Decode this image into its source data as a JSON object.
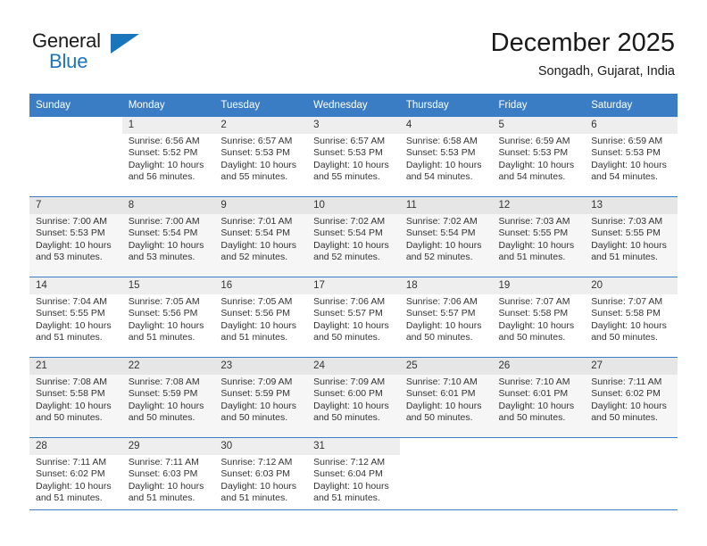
{
  "brand": {
    "name_part1": "General",
    "name_part2": "Blue",
    "logo_icon": "triangle-logo-icon"
  },
  "header": {
    "month_title": "December 2025",
    "location": "Songadh, Gujarat, India"
  },
  "calendar": {
    "weekday_headers": [
      "Sunday",
      "Monday",
      "Tuesday",
      "Wednesday",
      "Thursday",
      "Friday",
      "Saturday"
    ],
    "accent_color": "#3b7dc4",
    "daynum_band_color": "#eeeeee",
    "alt_row_color": "#f6f6f6",
    "weeks": [
      [
        {
          "day": "",
          "sunrise": "",
          "sunset": "",
          "daylight_line1": "",
          "daylight_line2": ""
        },
        {
          "day": "1",
          "sunrise": "Sunrise: 6:56 AM",
          "sunset": "Sunset: 5:52 PM",
          "daylight_line1": "Daylight: 10 hours",
          "daylight_line2": "and 56 minutes."
        },
        {
          "day": "2",
          "sunrise": "Sunrise: 6:57 AM",
          "sunset": "Sunset: 5:53 PM",
          "daylight_line1": "Daylight: 10 hours",
          "daylight_line2": "and 55 minutes."
        },
        {
          "day": "3",
          "sunrise": "Sunrise: 6:57 AM",
          "sunset": "Sunset: 5:53 PM",
          "daylight_line1": "Daylight: 10 hours",
          "daylight_line2": "and 55 minutes."
        },
        {
          "day": "4",
          "sunrise": "Sunrise: 6:58 AM",
          "sunset": "Sunset: 5:53 PM",
          "daylight_line1": "Daylight: 10 hours",
          "daylight_line2": "and 54 minutes."
        },
        {
          "day": "5",
          "sunrise": "Sunrise: 6:59 AM",
          "sunset": "Sunset: 5:53 PM",
          "daylight_line1": "Daylight: 10 hours",
          "daylight_line2": "and 54 minutes."
        },
        {
          "day": "6",
          "sunrise": "Sunrise: 6:59 AM",
          "sunset": "Sunset: 5:53 PM",
          "daylight_line1": "Daylight: 10 hours",
          "daylight_line2": "and 54 minutes."
        }
      ],
      [
        {
          "day": "7",
          "sunrise": "Sunrise: 7:00 AM",
          "sunset": "Sunset: 5:53 PM",
          "daylight_line1": "Daylight: 10 hours",
          "daylight_line2": "and 53 minutes."
        },
        {
          "day": "8",
          "sunrise": "Sunrise: 7:00 AM",
          "sunset": "Sunset: 5:54 PM",
          "daylight_line1": "Daylight: 10 hours",
          "daylight_line2": "and 53 minutes."
        },
        {
          "day": "9",
          "sunrise": "Sunrise: 7:01 AM",
          "sunset": "Sunset: 5:54 PM",
          "daylight_line1": "Daylight: 10 hours",
          "daylight_line2": "and 52 minutes."
        },
        {
          "day": "10",
          "sunrise": "Sunrise: 7:02 AM",
          "sunset": "Sunset: 5:54 PM",
          "daylight_line1": "Daylight: 10 hours",
          "daylight_line2": "and 52 minutes."
        },
        {
          "day": "11",
          "sunrise": "Sunrise: 7:02 AM",
          "sunset": "Sunset: 5:54 PM",
          "daylight_line1": "Daylight: 10 hours",
          "daylight_line2": "and 52 minutes."
        },
        {
          "day": "12",
          "sunrise": "Sunrise: 7:03 AM",
          "sunset": "Sunset: 5:55 PM",
          "daylight_line1": "Daylight: 10 hours",
          "daylight_line2": "and 51 minutes."
        },
        {
          "day": "13",
          "sunrise": "Sunrise: 7:03 AM",
          "sunset": "Sunset: 5:55 PM",
          "daylight_line1": "Daylight: 10 hours",
          "daylight_line2": "and 51 minutes."
        }
      ],
      [
        {
          "day": "14",
          "sunrise": "Sunrise: 7:04 AM",
          "sunset": "Sunset: 5:55 PM",
          "daylight_line1": "Daylight: 10 hours",
          "daylight_line2": "and 51 minutes."
        },
        {
          "day": "15",
          "sunrise": "Sunrise: 7:05 AM",
          "sunset": "Sunset: 5:56 PM",
          "daylight_line1": "Daylight: 10 hours",
          "daylight_line2": "and 51 minutes."
        },
        {
          "day": "16",
          "sunrise": "Sunrise: 7:05 AM",
          "sunset": "Sunset: 5:56 PM",
          "daylight_line1": "Daylight: 10 hours",
          "daylight_line2": "and 51 minutes."
        },
        {
          "day": "17",
          "sunrise": "Sunrise: 7:06 AM",
          "sunset": "Sunset: 5:57 PM",
          "daylight_line1": "Daylight: 10 hours",
          "daylight_line2": "and 50 minutes."
        },
        {
          "day": "18",
          "sunrise": "Sunrise: 7:06 AM",
          "sunset": "Sunset: 5:57 PM",
          "daylight_line1": "Daylight: 10 hours",
          "daylight_line2": "and 50 minutes."
        },
        {
          "day": "19",
          "sunrise": "Sunrise: 7:07 AM",
          "sunset": "Sunset: 5:58 PM",
          "daylight_line1": "Daylight: 10 hours",
          "daylight_line2": "and 50 minutes."
        },
        {
          "day": "20",
          "sunrise": "Sunrise: 7:07 AM",
          "sunset": "Sunset: 5:58 PM",
          "daylight_line1": "Daylight: 10 hours",
          "daylight_line2": "and 50 minutes."
        }
      ],
      [
        {
          "day": "21",
          "sunrise": "Sunrise: 7:08 AM",
          "sunset": "Sunset: 5:58 PM",
          "daylight_line1": "Daylight: 10 hours",
          "daylight_line2": "and 50 minutes."
        },
        {
          "day": "22",
          "sunrise": "Sunrise: 7:08 AM",
          "sunset": "Sunset: 5:59 PM",
          "daylight_line1": "Daylight: 10 hours",
          "daylight_line2": "and 50 minutes."
        },
        {
          "day": "23",
          "sunrise": "Sunrise: 7:09 AM",
          "sunset": "Sunset: 5:59 PM",
          "daylight_line1": "Daylight: 10 hours",
          "daylight_line2": "and 50 minutes."
        },
        {
          "day": "24",
          "sunrise": "Sunrise: 7:09 AM",
          "sunset": "Sunset: 6:00 PM",
          "daylight_line1": "Daylight: 10 hours",
          "daylight_line2": "and 50 minutes."
        },
        {
          "day": "25",
          "sunrise": "Sunrise: 7:10 AM",
          "sunset": "Sunset: 6:01 PM",
          "daylight_line1": "Daylight: 10 hours",
          "daylight_line2": "and 50 minutes."
        },
        {
          "day": "26",
          "sunrise": "Sunrise: 7:10 AM",
          "sunset": "Sunset: 6:01 PM",
          "daylight_line1": "Daylight: 10 hours",
          "daylight_line2": "and 50 minutes."
        },
        {
          "day": "27",
          "sunrise": "Sunrise: 7:11 AM",
          "sunset": "Sunset: 6:02 PM",
          "daylight_line1": "Daylight: 10 hours",
          "daylight_line2": "and 50 minutes."
        }
      ],
      [
        {
          "day": "28",
          "sunrise": "Sunrise: 7:11 AM",
          "sunset": "Sunset: 6:02 PM",
          "daylight_line1": "Daylight: 10 hours",
          "daylight_line2": "and 51 minutes."
        },
        {
          "day": "29",
          "sunrise": "Sunrise: 7:11 AM",
          "sunset": "Sunset: 6:03 PM",
          "daylight_line1": "Daylight: 10 hours",
          "daylight_line2": "and 51 minutes."
        },
        {
          "day": "30",
          "sunrise": "Sunrise: 7:12 AM",
          "sunset": "Sunset: 6:03 PM",
          "daylight_line1": "Daylight: 10 hours",
          "daylight_line2": "and 51 minutes."
        },
        {
          "day": "31",
          "sunrise": "Sunrise: 7:12 AM",
          "sunset": "Sunset: 6:04 PM",
          "daylight_line1": "Daylight: 10 hours",
          "daylight_line2": "and 51 minutes."
        },
        {
          "day": "",
          "sunrise": "",
          "sunset": "",
          "daylight_line1": "",
          "daylight_line2": ""
        },
        {
          "day": "",
          "sunrise": "",
          "sunset": "",
          "daylight_line1": "",
          "daylight_line2": ""
        },
        {
          "day": "",
          "sunrise": "",
          "sunset": "",
          "daylight_line1": "",
          "daylight_line2": ""
        }
      ]
    ]
  }
}
